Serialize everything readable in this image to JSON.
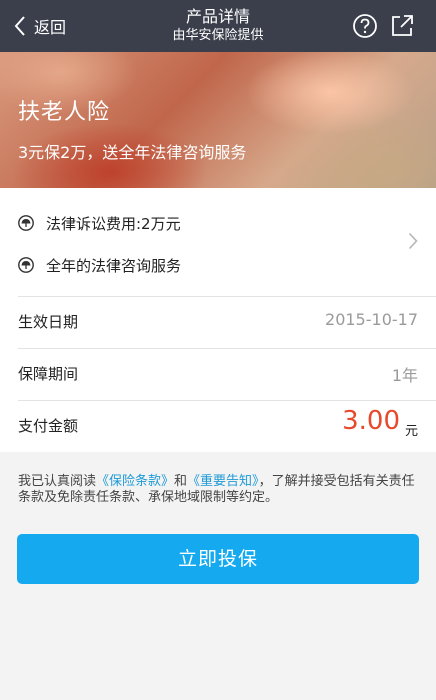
{
  "header": {
    "back_label": "返回",
    "title": "产品详情",
    "subtitle": "由华安保险提供",
    "help_icon": "help-circle-icon",
    "share_icon": "share-out-icon",
    "background": "#3b3f4c"
  },
  "banner": {
    "title": "扶老人险",
    "subtitle": "3元保2万，送全年法律咨询服务"
  },
  "coverage": {
    "items": [
      {
        "icon": "umbrella-icon",
        "label": "法律诉讼费用:2万元"
      },
      {
        "icon": "umbrella-icon",
        "label": "全年的法律咨询服务"
      }
    ],
    "chevron_icon": "chevron-right-icon"
  },
  "details": {
    "effective_date": {
      "label": "生效日期",
      "value": "2015-10-17"
    },
    "period": {
      "label": "保障期间",
      "value": "1年"
    },
    "payment": {
      "label": "支付金额",
      "amount": "3.00",
      "unit": "元",
      "color": "#e8492c"
    }
  },
  "agreement": {
    "prefix": "我已认真阅读",
    "terms_link": "《保险条款》",
    "and": "和",
    "notice_link": "《重要告知》",
    "suffix": "，了解并接受包括有关责任条款及免除责任条款、承保地域限制等约定。",
    "link_color": "#1e9ad6"
  },
  "action": {
    "buy_label": "立即投保",
    "color": "#15aaf0"
  }
}
